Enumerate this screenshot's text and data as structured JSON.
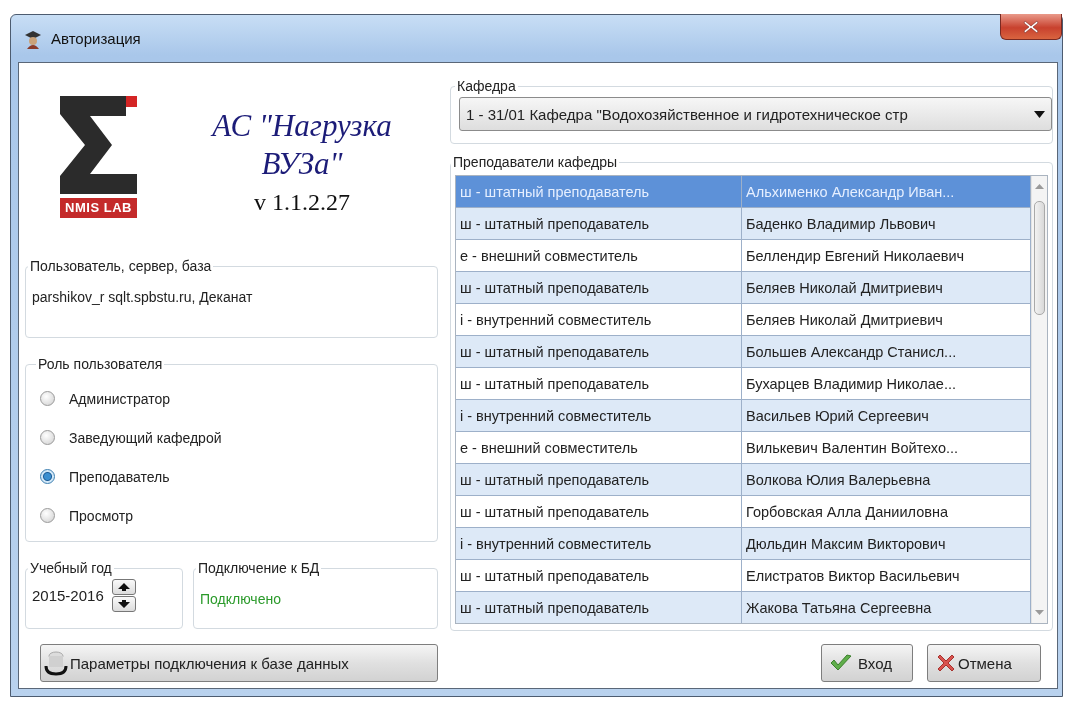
{
  "window": {
    "title": "Авторизация"
  },
  "logo": {
    "caption": "NMIS LAB"
  },
  "app_title": {
    "name": "АС \"Нагрузка ВУЗа\"",
    "version": "v 1.1.2.27"
  },
  "connection_info": {
    "label": "Пользователь, сервер, база",
    "value": "parshikov_r sqlt.spbstu.ru,  Деканат"
  },
  "role": {
    "label": "Роль пользователя",
    "options": [
      {
        "label": "Администратор",
        "selected": false
      },
      {
        "label": "Заведующий кафедрой",
        "selected": false
      },
      {
        "label": "Преподаватель",
        "selected": true
      },
      {
        "label": "Просмотр",
        "selected": false
      }
    ]
  },
  "academic_year": {
    "label": "Учебный год",
    "value": "2015-2016"
  },
  "db_connection": {
    "label": "Подключение к БД",
    "status": "Подключено"
  },
  "db_settings_button": "Параметры подключения к базе данных",
  "department": {
    "label": "Кафедра",
    "value": "1 - 31/01 Кафедра \"Водохозяйственное и гидротехническое стр"
  },
  "teachers": {
    "label": "Преподаватели кафедры",
    "rows": [
      {
        "type": "ш - штатный преподаватель",
        "name": "Альхименко Александр Иван...",
        "selected": true
      },
      {
        "type": "ш - штатный преподаватель",
        "name": "Баденко Владимир Львович",
        "selected": false
      },
      {
        "type": "е - внешний совместитель",
        "name": "Беллендир Евгений Николаевич",
        "selected": false
      },
      {
        "type": "ш - штатный преподаватель",
        "name": "Беляев Николай Дмитриевич",
        "selected": false
      },
      {
        "type": "i - внутренний совместитель",
        "name": "Беляев Николай Дмитриевич",
        "selected": false
      },
      {
        "type": "ш - штатный преподаватель",
        "name": "Большев Александр Станисл...",
        "selected": false
      },
      {
        "type": "ш - штатный преподаватель",
        "name": "Бухарцев Владимир Николае...",
        "selected": false
      },
      {
        "type": "i - внутренний совместитель",
        "name": "Васильев Юрий Сергеевич",
        "selected": false
      },
      {
        "type": "е - внешний совместитель",
        "name": "Вилькевич Валентин Войтехо...",
        "selected": false
      },
      {
        "type": "ш - штатный преподаватель",
        "name": "Волкова Юлия Валерьевна",
        "selected": false
      },
      {
        "type": "ш - штатный преподаватель",
        "name": "Горбовская Алла Данииловна",
        "selected": false
      },
      {
        "type": "i - внутренний совместитель",
        "name": "Дюльдин Максим Викторович",
        "selected": false
      },
      {
        "type": "ш - штатный преподаватель",
        "name": "Елистратов Виктор Васильевич",
        "selected": false
      },
      {
        "type": "ш - штатный преподаватель",
        "name": "Жакова Татьяна Сергеевна",
        "selected": false
      }
    ]
  },
  "buttons": [
    {
      "kind": "ok",
      "label": "Вход"
    },
    {
      "kind": "cancel",
      "label": "Отмена"
    }
  ]
}
